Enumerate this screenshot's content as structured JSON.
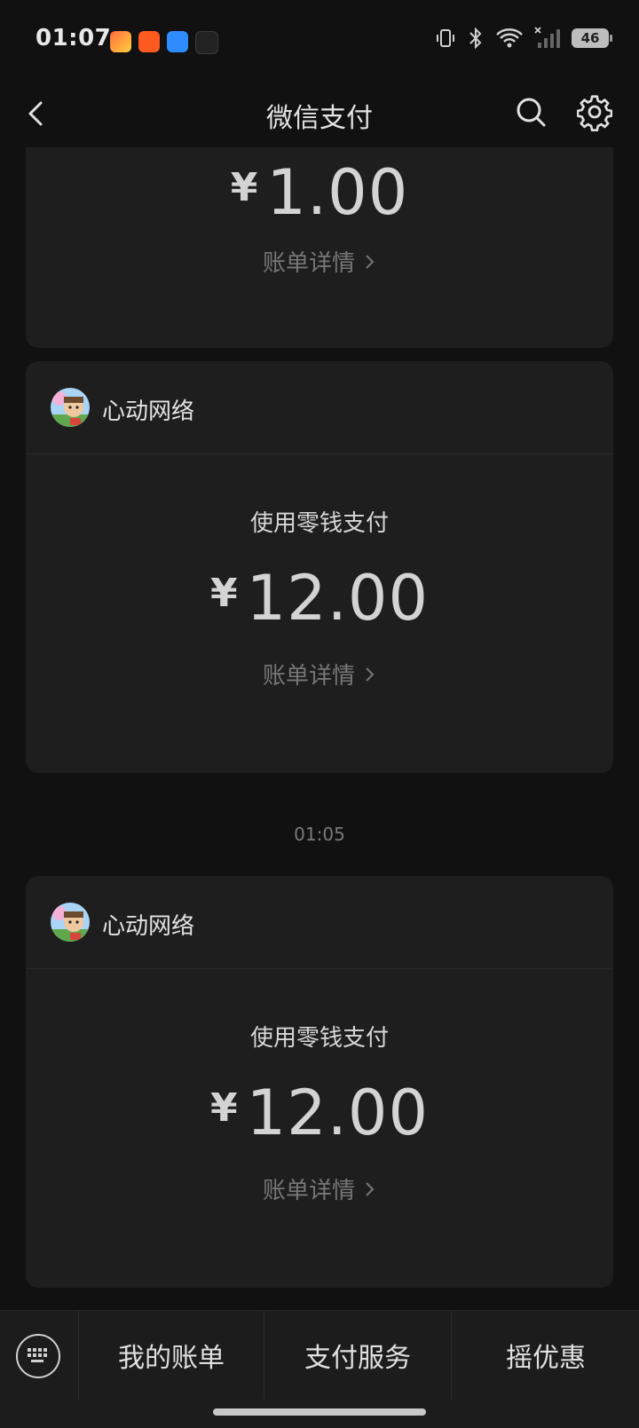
{
  "status_bar": {
    "time": "01:07",
    "battery": "46",
    "icons": [
      "vibrate-icon",
      "bluetooth-icon",
      "wifi-icon",
      "cellular-signal-icon",
      "battery-icon"
    ]
  },
  "header": {
    "title": "微信支付",
    "back_icon": "chevron-left-icon",
    "search_icon": "search-icon",
    "settings_icon": "gear-icon"
  },
  "messages": [
    {
      "amount_currency": "¥",
      "amount": "1.00",
      "detail_label": "账单详情"
    },
    {
      "merchant": "心动网络",
      "pay_method": "使用零钱支付",
      "amount_currency": "¥",
      "amount": "12.00",
      "detail_label": "账单详情"
    },
    {
      "timestamp": "01:05",
      "merchant": "心动网络",
      "pay_method": "使用零钱支付",
      "amount_currency": "¥",
      "amount": "12.00",
      "detail_label": "账单详情"
    }
  ],
  "bottom_menu": {
    "keyboard_icon": "keyboard-icon",
    "items": [
      "我的账单",
      "支付服务",
      "摇优惠"
    ]
  },
  "colors": {
    "background": "#111111",
    "card": "#1e1e1e",
    "text": "#d6d6d6",
    "muted": "#777777"
  }
}
